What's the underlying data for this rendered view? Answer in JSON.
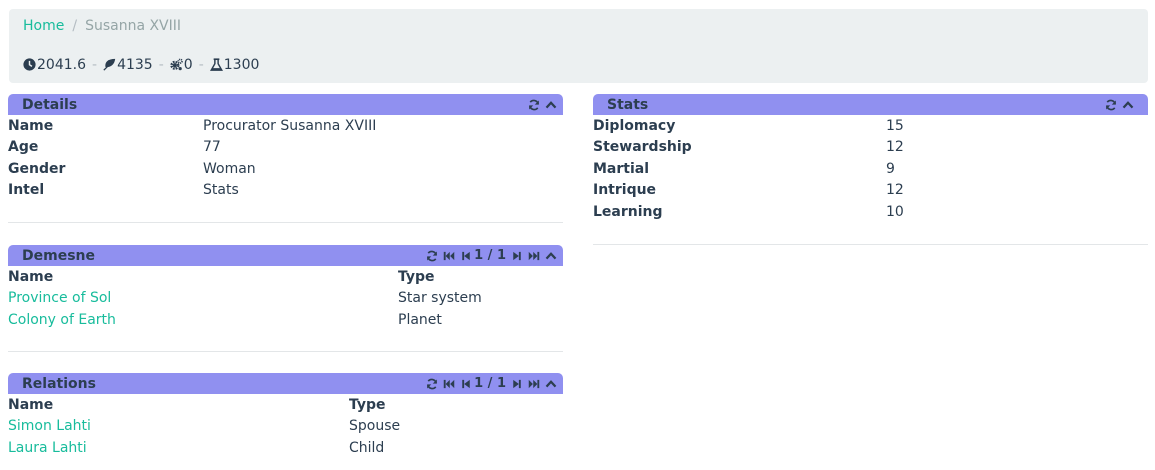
{
  "breadcrumb": {
    "home": "Home",
    "current": "Susanna XVIII"
  },
  "resources": [
    {
      "icon": "clock-icon",
      "value": "2041.6"
    },
    {
      "icon": "leaf-icon",
      "value": "4135"
    },
    {
      "icon": "cogs-icon",
      "value": "0"
    },
    {
      "icon": "flask-icon",
      "value": "1300"
    }
  ],
  "details": {
    "title": "Details",
    "rows": [
      {
        "label": "Name",
        "value": "Procurator Susanna XVIII"
      },
      {
        "label": "Age",
        "value": "77"
      },
      {
        "label": "Gender",
        "value": "Woman"
      },
      {
        "label": "Intel",
        "value": "Stats"
      }
    ]
  },
  "stats": {
    "title": "Stats",
    "rows": [
      {
        "label": "Diplomacy",
        "value": "15"
      },
      {
        "label": "Stewardship",
        "value": "12"
      },
      {
        "label": "Martial",
        "value": "9"
      },
      {
        "label": "Intrique",
        "value": "12"
      },
      {
        "label": "Learning",
        "value": "10"
      }
    ]
  },
  "demesne": {
    "title": "Demesne",
    "pager": "1 / 1",
    "col_name": "Name",
    "col_type": "Type",
    "rows": [
      {
        "name": "Province of Sol",
        "type": "Star system"
      },
      {
        "name": "Colony of Earth",
        "type": "Planet"
      }
    ]
  },
  "relations": {
    "title": "Relations",
    "pager": "1 / 1",
    "col_name": "Name",
    "col_type": "Type",
    "rows": [
      {
        "name": "Simon Lahti",
        "type": "Spouse"
      },
      {
        "name": "Laura Lahti",
        "type": "Child"
      }
    ]
  },
  "colors": {
    "panel_header": "#9090f0",
    "link": "#18bc9c",
    "bar_bg": "#ecf0f1"
  }
}
